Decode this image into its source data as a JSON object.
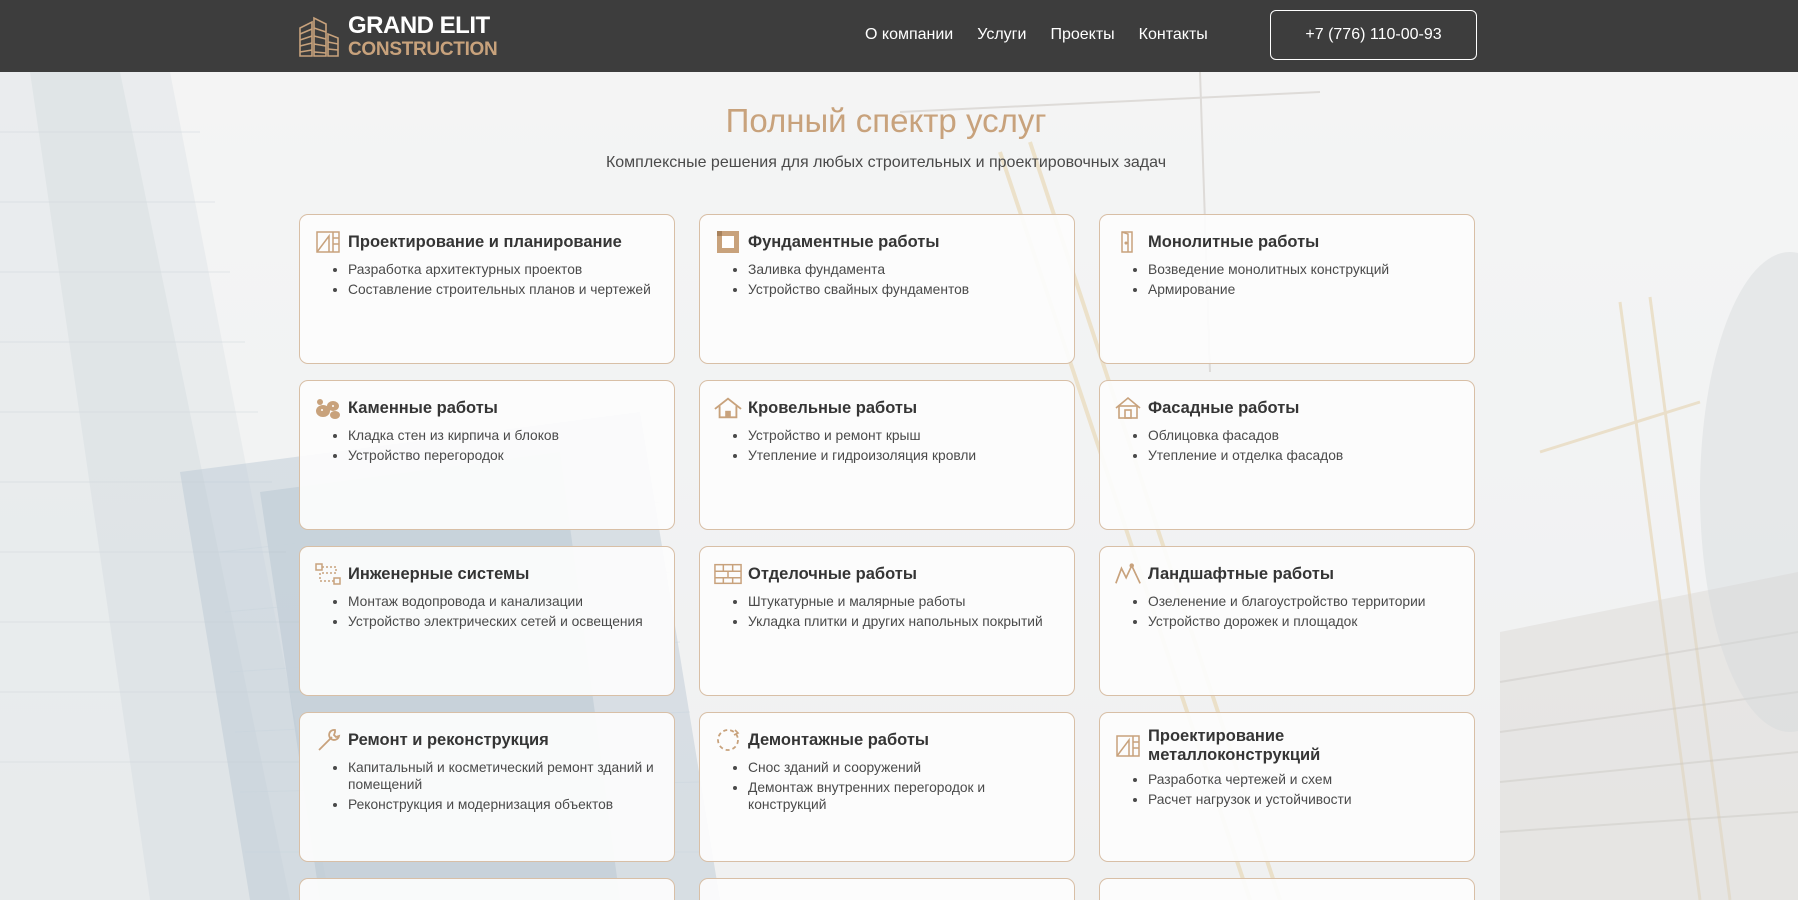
{
  "header": {
    "logo": {
      "line1": "GRAND ELIT",
      "line2": "CONSTRUCTION"
    },
    "nav": [
      {
        "label": "О компании"
      },
      {
        "label": "Услуги"
      },
      {
        "label": "Проекты"
      },
      {
        "label": "Контакты"
      }
    ],
    "phone": "+7 (776) 110-00-93"
  },
  "hero": {
    "title": "Полный спектр услуг",
    "subtitle": "Комплексные решения для любых строительных и проектировочных задач"
  },
  "colors": {
    "accent": "#c8a27c",
    "header_bg": "#3d3d3d",
    "card_border": "#d8bfa6",
    "text": "#3e3e3e"
  },
  "services": [
    {
      "icon": "blueprint-icon",
      "title": "Проектирование и планирование",
      "items": [
        "Разработка архитектурных проектов",
        "Составление строительных планов и чертежей"
      ]
    },
    {
      "icon": "foundation-icon",
      "title": "Фундаментные работы",
      "items": [
        "Заливка фундамента",
        "Устройство свайных фундаментов"
      ]
    },
    {
      "icon": "door-icon",
      "title": "Монолитные работы",
      "items": [
        "Возведение монолитных конструкций",
        "Армирование"
      ]
    },
    {
      "icon": "stones-icon",
      "title": "Каменные работы",
      "items": [
        "Кладка стен из кирпича и блоков",
        "Устройство перегородок"
      ]
    },
    {
      "icon": "roof-icon",
      "title": "Кровельные работы",
      "items": [
        "Устройство и ремонт крыш",
        "Утепление и гидроизоляция кровли"
      ]
    },
    {
      "icon": "house-icon",
      "title": "Фасадные работы",
      "items": [
        "Облицовка фасадов",
        "Утепление и отделка фасадов"
      ]
    },
    {
      "icon": "route-icon",
      "title": "Инженерные системы",
      "items": [
        "Монтаж водопровода и канализации",
        "Устройство электрических сетей и освещения"
      ]
    },
    {
      "icon": "bricks-icon",
      "title": "Отделочные работы",
      "items": [
        "Штукатурные и малярные работы",
        "Укладка плитки и других напольных покрытий"
      ]
    },
    {
      "icon": "landscape-icon",
      "title": "Ландшафтные работы",
      "items": [
        "Озеленение и благоустройство территории",
        "Устройство дорожек и площадок"
      ]
    },
    {
      "icon": "wrench-icon",
      "title": "Ремонт и реконструкция",
      "items": [
        "Капитальный и косметический ремонт зданий и помещений",
        "Реконструкция и модернизация объектов"
      ]
    },
    {
      "icon": "demolition-icon",
      "title": "Демонтажные работы",
      "items": [
        "Снос зданий и сооружений",
        "Демонтаж внутренних перегородок и конструкций"
      ]
    },
    {
      "icon": "steel-blueprint-icon",
      "title": "Проектирование металлоконструкций",
      "items": [
        "Разработка чертежей и схем",
        "Расчет нагрузок и устойчивости"
      ]
    }
  ]
}
